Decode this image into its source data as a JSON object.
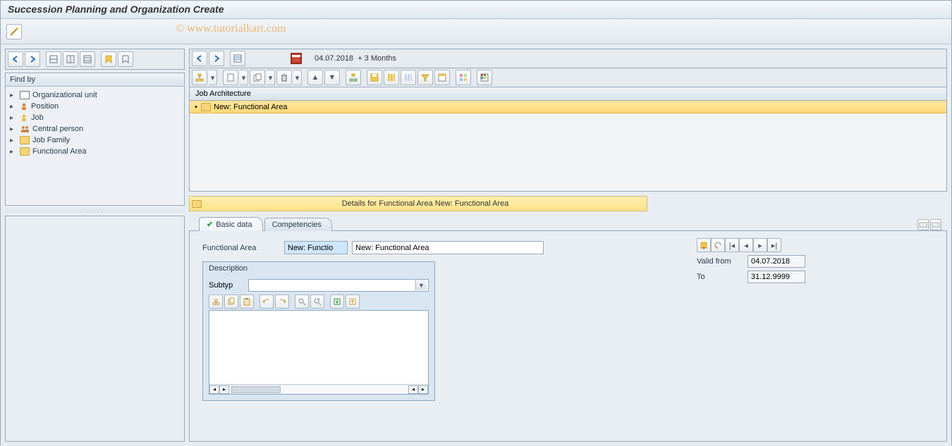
{
  "title": "Succession Planning and Organization Create",
  "watermark": "© www.tutorialkart.com",
  "date_indicator": {
    "date": "04.07.2018",
    "range_suffix": "+ 3 Months"
  },
  "find_by": {
    "header": "Find by",
    "items": [
      {
        "label": "Organizational unit",
        "icon": "org"
      },
      {
        "label": "Position",
        "icon": "pos"
      },
      {
        "label": "Job",
        "icon": "job"
      },
      {
        "label": "Central person",
        "icon": "person"
      },
      {
        "label": "Job Family",
        "icon": "folder"
      },
      {
        "label": "Functional Area",
        "icon": "folder"
      }
    ]
  },
  "job_architecture": {
    "header": "Job Architecture",
    "selected_node": "New: Functional Area"
  },
  "details_bar": "Details for Functional Area New: Functional Area",
  "tabs": [
    {
      "label": "Basic data",
      "active": true,
      "checked": true
    },
    {
      "label": "Competencies",
      "active": false,
      "checked": false
    }
  ],
  "form": {
    "label_functional_area": "Functional Area",
    "short_value": "New: Functio",
    "long_value": "New: Functional Area",
    "valid_from_label": "Valid from",
    "valid_from": "04.07.2018",
    "to_label": "To",
    "to": "31.12.9999"
  },
  "description": {
    "header": "Description",
    "subtyp_label": "Subtyp",
    "subtyp_value": "",
    "text": ""
  }
}
